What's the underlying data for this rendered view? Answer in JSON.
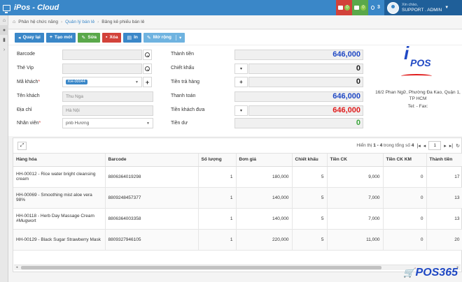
{
  "app": {
    "title": "iPos - Cloud"
  },
  "topbar": {
    "notifications": [
      {
        "icon": "chat-icon",
        "count": "0",
        "color": "#d2423a"
      },
      {
        "icon": "list-icon",
        "count": "0",
        "color": "#5aa84a"
      },
      {
        "icon": "dollar-icon",
        "count": "3",
        "color": "#3a87c8"
      }
    ],
    "user": {
      "greeting": "Xin chào,",
      "name": "SUPPORT . ADMIN"
    }
  },
  "breadcrumb": [
    "Phân hệ chức năng",
    "Quản lý bán lẻ",
    "Bảng kê phiếu bán lẻ"
  ],
  "toolbar": {
    "back": "Quay lại",
    "new": "Tạo mới",
    "edit": "Sửa",
    "delete": "Xóa",
    "print": "In",
    "extend": "Mở rộng"
  },
  "form": {
    "barcode": {
      "label": "Barcode",
      "value": ""
    },
    "vip": {
      "label": "Thẻ Vip",
      "value": ""
    },
    "customer_code": {
      "label": "Mã khách",
      "tag": "KH-00044"
    },
    "customer_name": {
      "label": "Tên khách",
      "value": "Thu Nga"
    },
    "address": {
      "label": "Địa chỉ",
      "value": "Hà Nội"
    },
    "staff": {
      "label": "Nhân viên",
      "value": "pnb Hương"
    }
  },
  "totals": {
    "subtotal": {
      "label": "Thành tiền",
      "value": "646,000"
    },
    "discount": {
      "label": "Chiết khấu",
      "value": "0"
    },
    "returned": {
      "label": "Tiền trả hàng",
      "value": "0"
    },
    "payment": {
      "label": "Thanh toán",
      "value": "646,000"
    },
    "customer_paid": {
      "label": "Tiền khách đưa",
      "value": "646,000"
    },
    "change": {
      "label": "Tiền dư",
      "value": "0"
    }
  },
  "store": {
    "address": "16/2 Phan Ngữ, Phường Đa Kao, Quận 1, TP HCM",
    "contact": "Tel: - Fax:",
    "logo_text": "POS"
  },
  "grid": {
    "pager": {
      "prefix": "Hiển thị",
      "range": "1 - 4",
      "mid": "trong tổng số",
      "total": "4",
      "page": "1"
    },
    "columns": [
      "Hàng hóa",
      "Barcode",
      "Số lượng",
      "Đơn giá",
      "Chiết khấu",
      "Tiền CK",
      "Tiền CK KM",
      "Thành tiền"
    ],
    "rows": [
      [
        "HH-00012 - Rice water bright cleansing cream",
        "8806364019298",
        "1",
        "180,000",
        "5",
        "9,000",
        "0",
        "17"
      ],
      [
        "HH-00069 - Smoothing mist aloe vera 98%",
        "8809248457377",
        "1",
        "140,000",
        "5",
        "7,000",
        "0",
        "13"
      ],
      [
        "HH-00118 - Herb Day Massage Cream #Mugwort",
        "8806364003358",
        "1",
        "140,000",
        "5",
        "7,000",
        "0",
        "13"
      ],
      [
        "HH-00129 - Black Sugar Strawberry Mask",
        "8809327946105",
        "1",
        "220,000",
        "5",
        "11,000",
        "0",
        "20"
      ]
    ]
  },
  "watermark": "POS365"
}
